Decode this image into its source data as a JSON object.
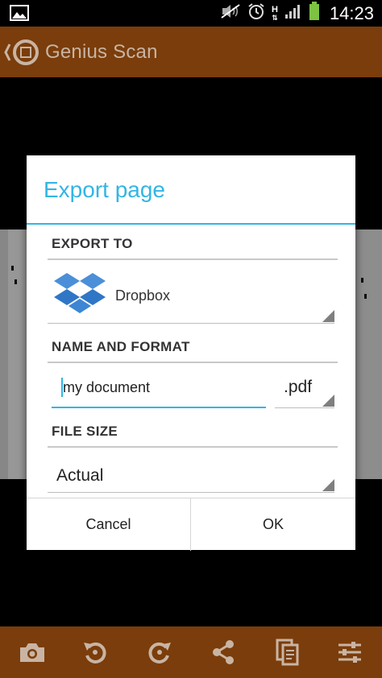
{
  "status_bar": {
    "time": "14:23",
    "network_type": "H",
    "icons": [
      "gallery-icon",
      "mute-icon",
      "alarm-icon",
      "network-type-icon",
      "signal-icon",
      "battery-icon"
    ]
  },
  "action_bar": {
    "title": "Genius Scan",
    "color": "#7a3d0b"
  },
  "dialog": {
    "title": "Export page",
    "accent_color": "#33b5e5",
    "export_to": {
      "header": "EXPORT TO",
      "selected": "Dropbox",
      "icon": "dropbox-icon"
    },
    "name_and_format": {
      "header": "NAME AND FORMAT",
      "name_value": "my document",
      "format": ".pdf"
    },
    "file_size": {
      "header": "FILE SIZE",
      "selected": "Actual"
    },
    "buttons": {
      "cancel": "Cancel",
      "ok": "OK"
    }
  },
  "bottom_toolbar": {
    "items": [
      "camera-icon",
      "rotate-left-icon",
      "rotate-right-icon",
      "share-icon",
      "pages-icon",
      "settings-sliders-icon"
    ]
  }
}
